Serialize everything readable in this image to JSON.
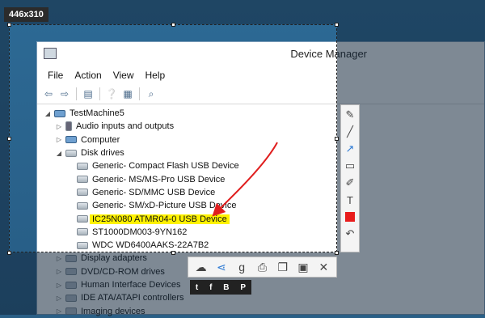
{
  "screenshot_tool": {
    "size_badge": "446x310",
    "side_tools": [
      "pen-icon",
      "line-icon",
      "arrow-icon",
      "rectangle-icon",
      "marker-icon",
      "text-icon",
      "color-swatch",
      "undo-icon"
    ],
    "text_tool_label": "T",
    "selected_color": "#e81c1c",
    "bottom_tools": [
      "upload-icon",
      "share-icon",
      "search-icon",
      "print-icon",
      "copy-icon",
      "save-icon",
      "close-icon"
    ],
    "social": [
      "t",
      "f",
      "B",
      "P"
    ]
  },
  "window": {
    "title": "Device Manager",
    "menu": [
      "File",
      "Action",
      "View",
      "Help"
    ]
  },
  "tree": [
    {
      "label": "TestMachine5",
      "expander": "◢",
      "icon": "computer-icon",
      "indent": 0
    },
    {
      "label": "Audio inputs and outputs",
      "expander": "▷",
      "icon": "audio-icon",
      "indent": 1
    },
    {
      "label": "Computer",
      "expander": "▷",
      "icon": "computer-icon",
      "indent": 1
    },
    {
      "label": "Disk drives",
      "expander": "◢",
      "icon": "disk-icon",
      "indent": 1
    },
    {
      "label": "Generic- Compact Flash USB Device",
      "expander": "",
      "icon": "disk-icon",
      "indent": 2
    },
    {
      "label": "Generic- MS/MS-Pro USB Device",
      "expander": "",
      "icon": "disk-icon",
      "indent": 2
    },
    {
      "label": "Generic- SD/MMC USB Device",
      "expander": "",
      "icon": "disk-icon",
      "indent": 2
    },
    {
      "label": "Generic- SM/xD-Picture USB Device",
      "expander": "",
      "icon": "disk-icon",
      "indent": 2
    },
    {
      "label": "IC25N080 ATMR04-0 USB Device",
      "expander": "",
      "icon": "disk-icon",
      "indent": 2,
      "highlighted": true
    },
    {
      "label": "ST1000DM003-9YN162",
      "expander": "",
      "icon": "disk-icon",
      "indent": 2
    },
    {
      "label": "WDC WD6400AAKS-22A7B2",
      "expander": "",
      "icon": "disk-icon",
      "indent": 2
    },
    {
      "label": "Display adapters",
      "expander": "▷",
      "icon": "display-icon",
      "indent": 1
    },
    {
      "label": "DVD/CD-ROM drives",
      "expander": "▷",
      "icon": "dvd-icon",
      "indent": 1
    },
    {
      "label": "Human Interface Devices",
      "expander": "▷",
      "icon": "hid-icon",
      "indent": 1
    },
    {
      "label": "IDE ATA/ATAPI controllers",
      "expander": "▷",
      "icon": "ide-icon",
      "indent": 1
    },
    {
      "label": "Imaging devices",
      "expander": "▷",
      "icon": "camera-icon",
      "indent": 1
    }
  ],
  "annotation": {
    "color": "#e01e1e",
    "highlight_color": "#fff200"
  }
}
